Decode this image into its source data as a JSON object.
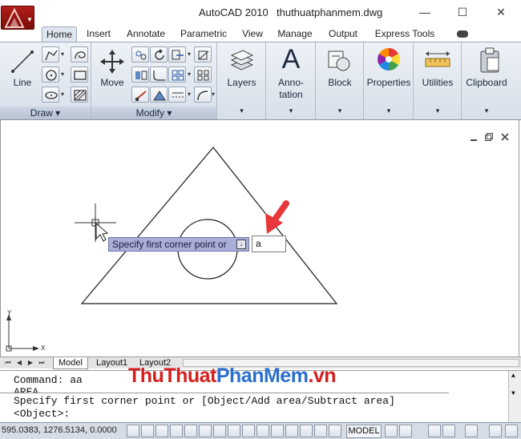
{
  "window": {
    "app_name": "AutoCAD 2010",
    "file_name": "thuthuatphanmem.dwg",
    "minimize": "—",
    "maximize": "☐",
    "close": "✕"
  },
  "tabs": [
    {
      "label": "Home",
      "active": true
    },
    {
      "label": "Insert"
    },
    {
      "label": "Annotate"
    },
    {
      "label": "Parametric"
    },
    {
      "label": "View"
    },
    {
      "label": "Manage"
    },
    {
      "label": "Output"
    },
    {
      "label": "Express Tools"
    }
  ],
  "ribbon": {
    "draw": {
      "title": "Draw",
      "line_label": "Line"
    },
    "modify": {
      "title": "Modify",
      "move_label": "Move"
    },
    "layers_label": "Layers",
    "annotation_label_1": "Anno-",
    "annotation_label_2": "tation",
    "block_label": "Block",
    "properties_label": "Properties",
    "utilities_label": "Utilities",
    "clipboard_label": "Clipboard",
    "panel_caret": "▾",
    "annotation_glyph": "A"
  },
  "drawing": {
    "tooltip_text": "Specify first corner point or",
    "tooltip_icon": "↓",
    "dynamic_input_value": "a",
    "ucs_x": "X",
    "ucs_y": "Y"
  },
  "layout_tabs": [
    {
      "label": "Model",
      "active": true
    },
    {
      "label": "Layout1"
    },
    {
      "label": "Layout2"
    }
  ],
  "command": {
    "history_1": "Command: aa",
    "history_2": "AREA",
    "prompt_1": "Specify first corner point or [Object/Add area/Subtract area]",
    "prompt_2": "<Object>:"
  },
  "watermark": {
    "part1": "ThuThuat",
    "part2": "PhanMem",
    "part3": ".vn"
  },
  "status": {
    "coordinates": "595.0383, 1276.5134, 0.0000",
    "model_label": "MODEL"
  },
  "colors": {
    "arrow": "#e8373b",
    "tooltip": "#a9aed8",
    "app_red": "#b22019"
  }
}
